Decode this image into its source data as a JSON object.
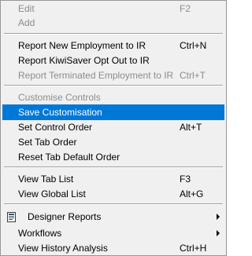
{
  "menu": {
    "items": [
      {
        "label": "Edit",
        "shortcut": "F2"
      },
      {
        "label": "Add",
        "shortcut": ""
      },
      {
        "label": "Report New Employment to IR",
        "shortcut": "Ctrl+N"
      },
      {
        "label": "Report KiwiSaver Opt Out to IR",
        "shortcut": ""
      },
      {
        "label": "Report Terminated Employment to IR",
        "shortcut": "Ctrl+T"
      },
      {
        "label": "Customise Controls",
        "shortcut": ""
      },
      {
        "label": "Save Customisation",
        "shortcut": ""
      },
      {
        "label": "Set Control Order",
        "shortcut": "Alt+T"
      },
      {
        "label": "Set Tab Order",
        "shortcut": ""
      },
      {
        "label": "Reset Tab Default Order",
        "shortcut": ""
      },
      {
        "label": "View Tab List",
        "shortcut": "F3"
      },
      {
        "label": "View Global List",
        "shortcut": "Alt+G"
      },
      {
        "label": "Designer Reports",
        "shortcut": "",
        "icon": "report-icon"
      },
      {
        "label": "Workflows",
        "shortcut": ""
      },
      {
        "label": "View History Analysis",
        "shortcut": "Ctrl+H"
      }
    ]
  },
  "colors": {
    "menu_background": "#f0f0f0",
    "highlight": "#0078d7",
    "disabled_text": "#8c8c8c"
  }
}
